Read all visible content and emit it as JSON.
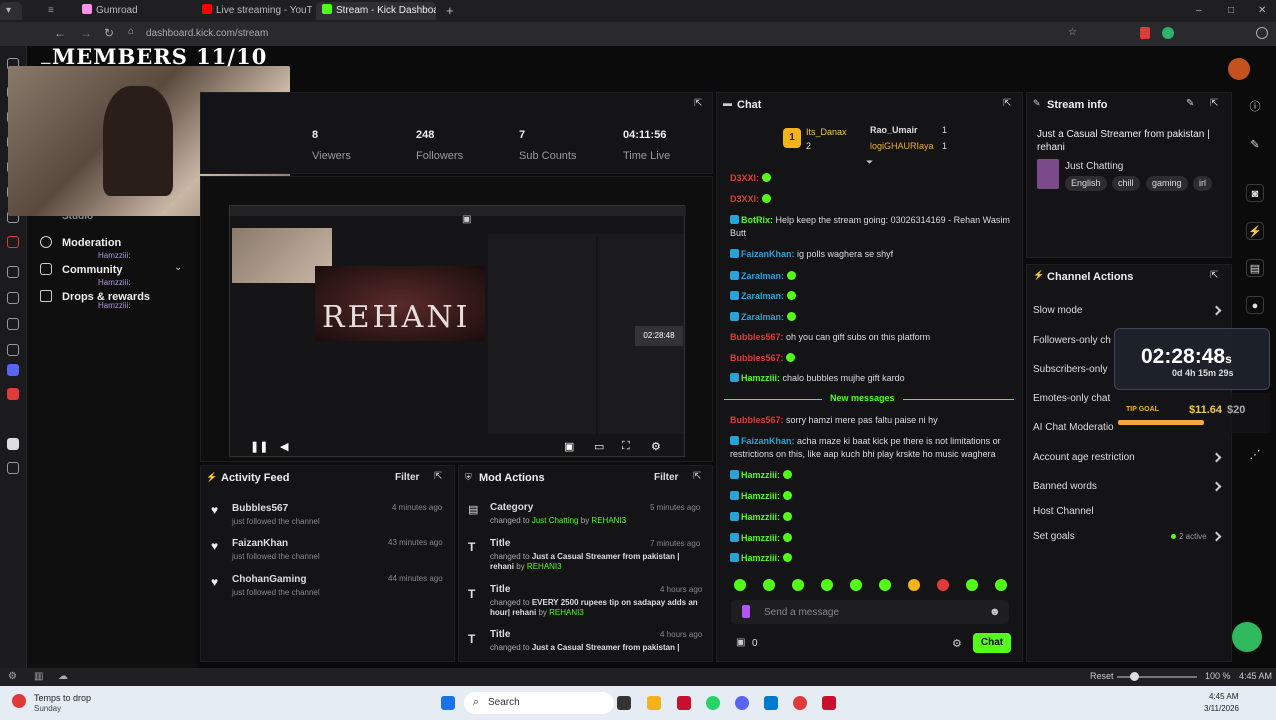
{
  "browser": {
    "tabs": [
      {
        "label": "Gumroad",
        "color": "#ff90e8"
      },
      {
        "label": "Live streaming - YouTube S",
        "color": "#ff0000"
      },
      {
        "label": "Stream - Kick Dashboard",
        "color": "#53fc18"
      }
    ],
    "url": "dashboard.kick.com/stream"
  },
  "overlay": {
    "members": "MEMBERS 11/10"
  },
  "sidebar": {
    "items": [
      {
        "label": "Studio"
      },
      {
        "label": "Moderation",
        "sub": "Hamzziii:"
      },
      {
        "label": "Community",
        "sub": "Hamzziii:"
      },
      {
        "label": "Drops & rewards",
        "sub": "Hamzziii:"
      }
    ]
  },
  "stats": [
    {
      "value": "8",
      "label": "Viewers"
    },
    {
      "value": "248",
      "label": "Followers"
    },
    {
      "value": "7",
      "label": "Sub Counts"
    },
    {
      "value": "04:11:56",
      "label": "Time Live"
    }
  ],
  "preview": {
    "logo_text": "REHANI"
  },
  "activity": {
    "title": "Activity Feed",
    "filter": "Filter",
    "items": [
      {
        "name": "Bubbles567",
        "text": "just followed the channel",
        "time": "4 minutes ago"
      },
      {
        "name": "FaizanKhan",
        "text": "just followed the channel",
        "time": "43 minutes ago"
      },
      {
        "name": "ChohanGaming",
        "text": "just followed the channel",
        "time": "44 minutes ago"
      }
    ]
  },
  "mod": {
    "title": "Mod Actions",
    "filter": "Filter",
    "items": [
      {
        "title": "Category",
        "time": "5 minutes ago",
        "prefix": "changed to ",
        "value": "Just Chatting",
        "by": " by ",
        "user": "REHANI3"
      },
      {
        "title": "Title",
        "time": "7 minutes ago",
        "prefix": "changed to ",
        "value": "Just a Casual Streamer from pakistan | rehani",
        "by": " by ",
        "user": "REHANI3"
      },
      {
        "title": "Title",
        "time": "4 hours ago",
        "prefix": "changed to ",
        "value": "EVERY 2500 rupees tip on sadapay adds an hour| rehani",
        "by": " by ",
        "user": "REHANI3"
      },
      {
        "title": "Title",
        "time": "4 hours ago",
        "prefix": "changed to ",
        "value": "Just a Casual Streamer from pakistan |",
        "by": "",
        "user": ""
      }
    ]
  },
  "chat": {
    "title": "Chat",
    "pinned": [
      {
        "rank": "1",
        "name": "Its_Danax",
        "count": "2"
      },
      {
        "name": "Rao_Umair",
        "count": "1"
      },
      {
        "name": "logiGHAURIaya",
        "count": "1"
      }
    ],
    "messages": [
      {
        "user": "D3XXI:",
        "text": "",
        "color": "#e03b3b"
      },
      {
        "user": "D3XXI:",
        "text": "",
        "color": "#e03b3b"
      },
      {
        "user": "BotRix:",
        "text": "Help keep the stream going: 03026314169 - Rehan Wasim Butt",
        "color": "#53fc18"
      },
      {
        "user": "FaizanKhan:",
        "text": "ig polls waghera se shyf",
        "color": "#28a3d8"
      },
      {
        "user": "Zaralman:",
        "text": "",
        "color": "#28a3d8"
      },
      {
        "user": "Zaralman:",
        "text": "",
        "color": "#28a3d8"
      },
      {
        "user": "Zaralman:",
        "text": "",
        "color": "#28a3d8"
      },
      {
        "user": "Bubbles567:",
        "text": "oh you can gift subs on this platform",
        "color": "#e03b3b"
      },
      {
        "user": "Bubbles567:",
        "text": "",
        "color": "#e03b3b"
      },
      {
        "user": "Hamzziii:",
        "text": "chalo bubbles mujhe gift kardo",
        "color": "#53fc18"
      }
    ],
    "new_messages": "New messages",
    "messages2": [
      {
        "user": "Bubbles567:",
        "text": "sorry hamzi mere pas faltu paise ni hy",
        "color": "#e03b3b"
      },
      {
        "user": "FaizanKhan:",
        "text": "acha maze ki baat kick pe there is not limitations or restrictions on this, like aap kuch bhi play krskte ho music waghera",
        "color": "#28a3d8"
      },
      {
        "user": "Hamzziii:",
        "text": "",
        "color": "#53fc18"
      },
      {
        "user": "Hamzziii:",
        "text": "",
        "color": "#53fc18"
      },
      {
        "user": "Hamzziii:",
        "text": "",
        "color": "#53fc18"
      },
      {
        "user": "Hamzziii:",
        "text": "",
        "color": "#53fc18"
      },
      {
        "user": "Hamzziii:",
        "text": "",
        "color": "#53fc18"
      }
    ],
    "placeholder": "Send a message",
    "points": "0",
    "send": "Chat"
  },
  "stream_info": {
    "title": "Stream info",
    "stream_title": "Just a Casual Streamer from pakistan | rehani",
    "category": "Just Chatting",
    "tags": [
      "English",
      "chill",
      "gaming",
      "irl"
    ]
  },
  "channel_actions": {
    "title": "Channel Actions",
    "items": [
      {
        "label": "Slow mode"
      },
      {
        "label": "Followers-only ch"
      },
      {
        "label": "Subscribers-only"
      },
      {
        "label": "Emotes-only chat"
      },
      {
        "label": "AI Chat Moderatio"
      },
      {
        "label": "Account age restriction"
      },
      {
        "label": "Banned words"
      },
      {
        "label": "Host Channel"
      },
      {
        "label": "Set goals",
        "extra": "2 active"
      }
    ]
  },
  "timer_overlay": {
    "time": "02:28:48",
    "unit": "s",
    "sub": "0d 4h 15m 29s",
    "goal_label": "TIP GOAL",
    "goal_amount": "$11.64",
    "goal_target": "$20"
  },
  "statusbar": {
    "reset": "Reset",
    "zoom": "100 %",
    "time": "4:45 AM"
  },
  "taskbar": {
    "notif_title": "Temps to drop",
    "notif_sub": "Sunday",
    "search": "Search",
    "time": "4:45 AM",
    "date": "3/11/2026"
  },
  "colors": {
    "kick_green": "#53fc18",
    "accent_blue": "#28a3d8"
  }
}
